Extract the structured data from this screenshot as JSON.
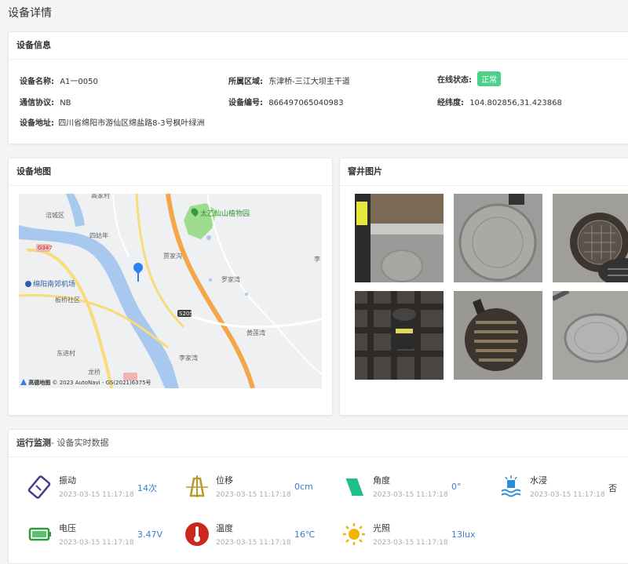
{
  "page": {
    "title": "设备详情"
  },
  "info": {
    "header": "设备信息",
    "name_label": "设备名称:",
    "name_value": "A1一0050",
    "region_label": "所属区域:",
    "region_value": "东津桥-三江大坝主干道",
    "status_label": "在线状态:",
    "status_value": "正常",
    "protocol_label": "通信协议:",
    "protocol_value": "NB",
    "code_label": "设备编号:",
    "code_value": "866497065040983",
    "coords_label": "经纬度:",
    "coords_value": "104.802856,31.423868",
    "address_label": "设备地址:",
    "address_value": "四川省绵阳市游仙区绵盐路8-3号枫叶绿洲"
  },
  "map": {
    "header": "设备地图",
    "labels": {
      "fucheng": "涪城区",
      "sizhinian": "四姑年",
      "huanxiqu": "板桥社区",
      "airport": "绵阳南郊机场",
      "bamboo": "太乙仙山植物园",
      "jiajia": "贾家沟",
      "luojia": "罗家湾",
      "huanglian": "黄莲湾",
      "lijia": "李家湾",
      "xiaojin": "东进村",
      "longqiao": "龙桥",
      "road_s205": "S205",
      "road_g347": "G347",
      "gaoshui": "高家村",
      "li": "李"
    },
    "brand": "高德地图",
    "copyright": "© 2023 AutoNavi - GS(2021)6375号",
    "accent": "#2f7ff0"
  },
  "photos": {
    "header": "窨井图片"
  },
  "monitor": {
    "header": "运行监测",
    "header_sub": "- 设备实时数据",
    "items": [
      {
        "name": "振动",
        "time": "2023-03-15 11:17:18",
        "value": "14次",
        "icon": "vibration-icon"
      },
      {
        "name": "位移",
        "time": "2023-03-15 11:17:18",
        "value": "0cm",
        "icon": "displacement-icon"
      },
      {
        "name": "角度",
        "time": "2023-03-15 11:17:18",
        "value": "0°",
        "icon": "angle-icon"
      },
      {
        "name": "水浸",
        "time": "2023-03-15 11:17:18",
        "value": "否",
        "icon": "water-icon"
      },
      {
        "name": "电压",
        "time": "2023-03-15 11:17:18",
        "value": "3.47V",
        "icon": "battery-icon"
      },
      {
        "name": "温度",
        "time": "2023-03-15 11:17:18",
        "value": "16℃",
        "icon": "thermometer-icon"
      },
      {
        "name": "光照",
        "time": "2023-03-15 11:17:18",
        "value": "13lux",
        "icon": "sun-icon"
      }
    ]
  }
}
